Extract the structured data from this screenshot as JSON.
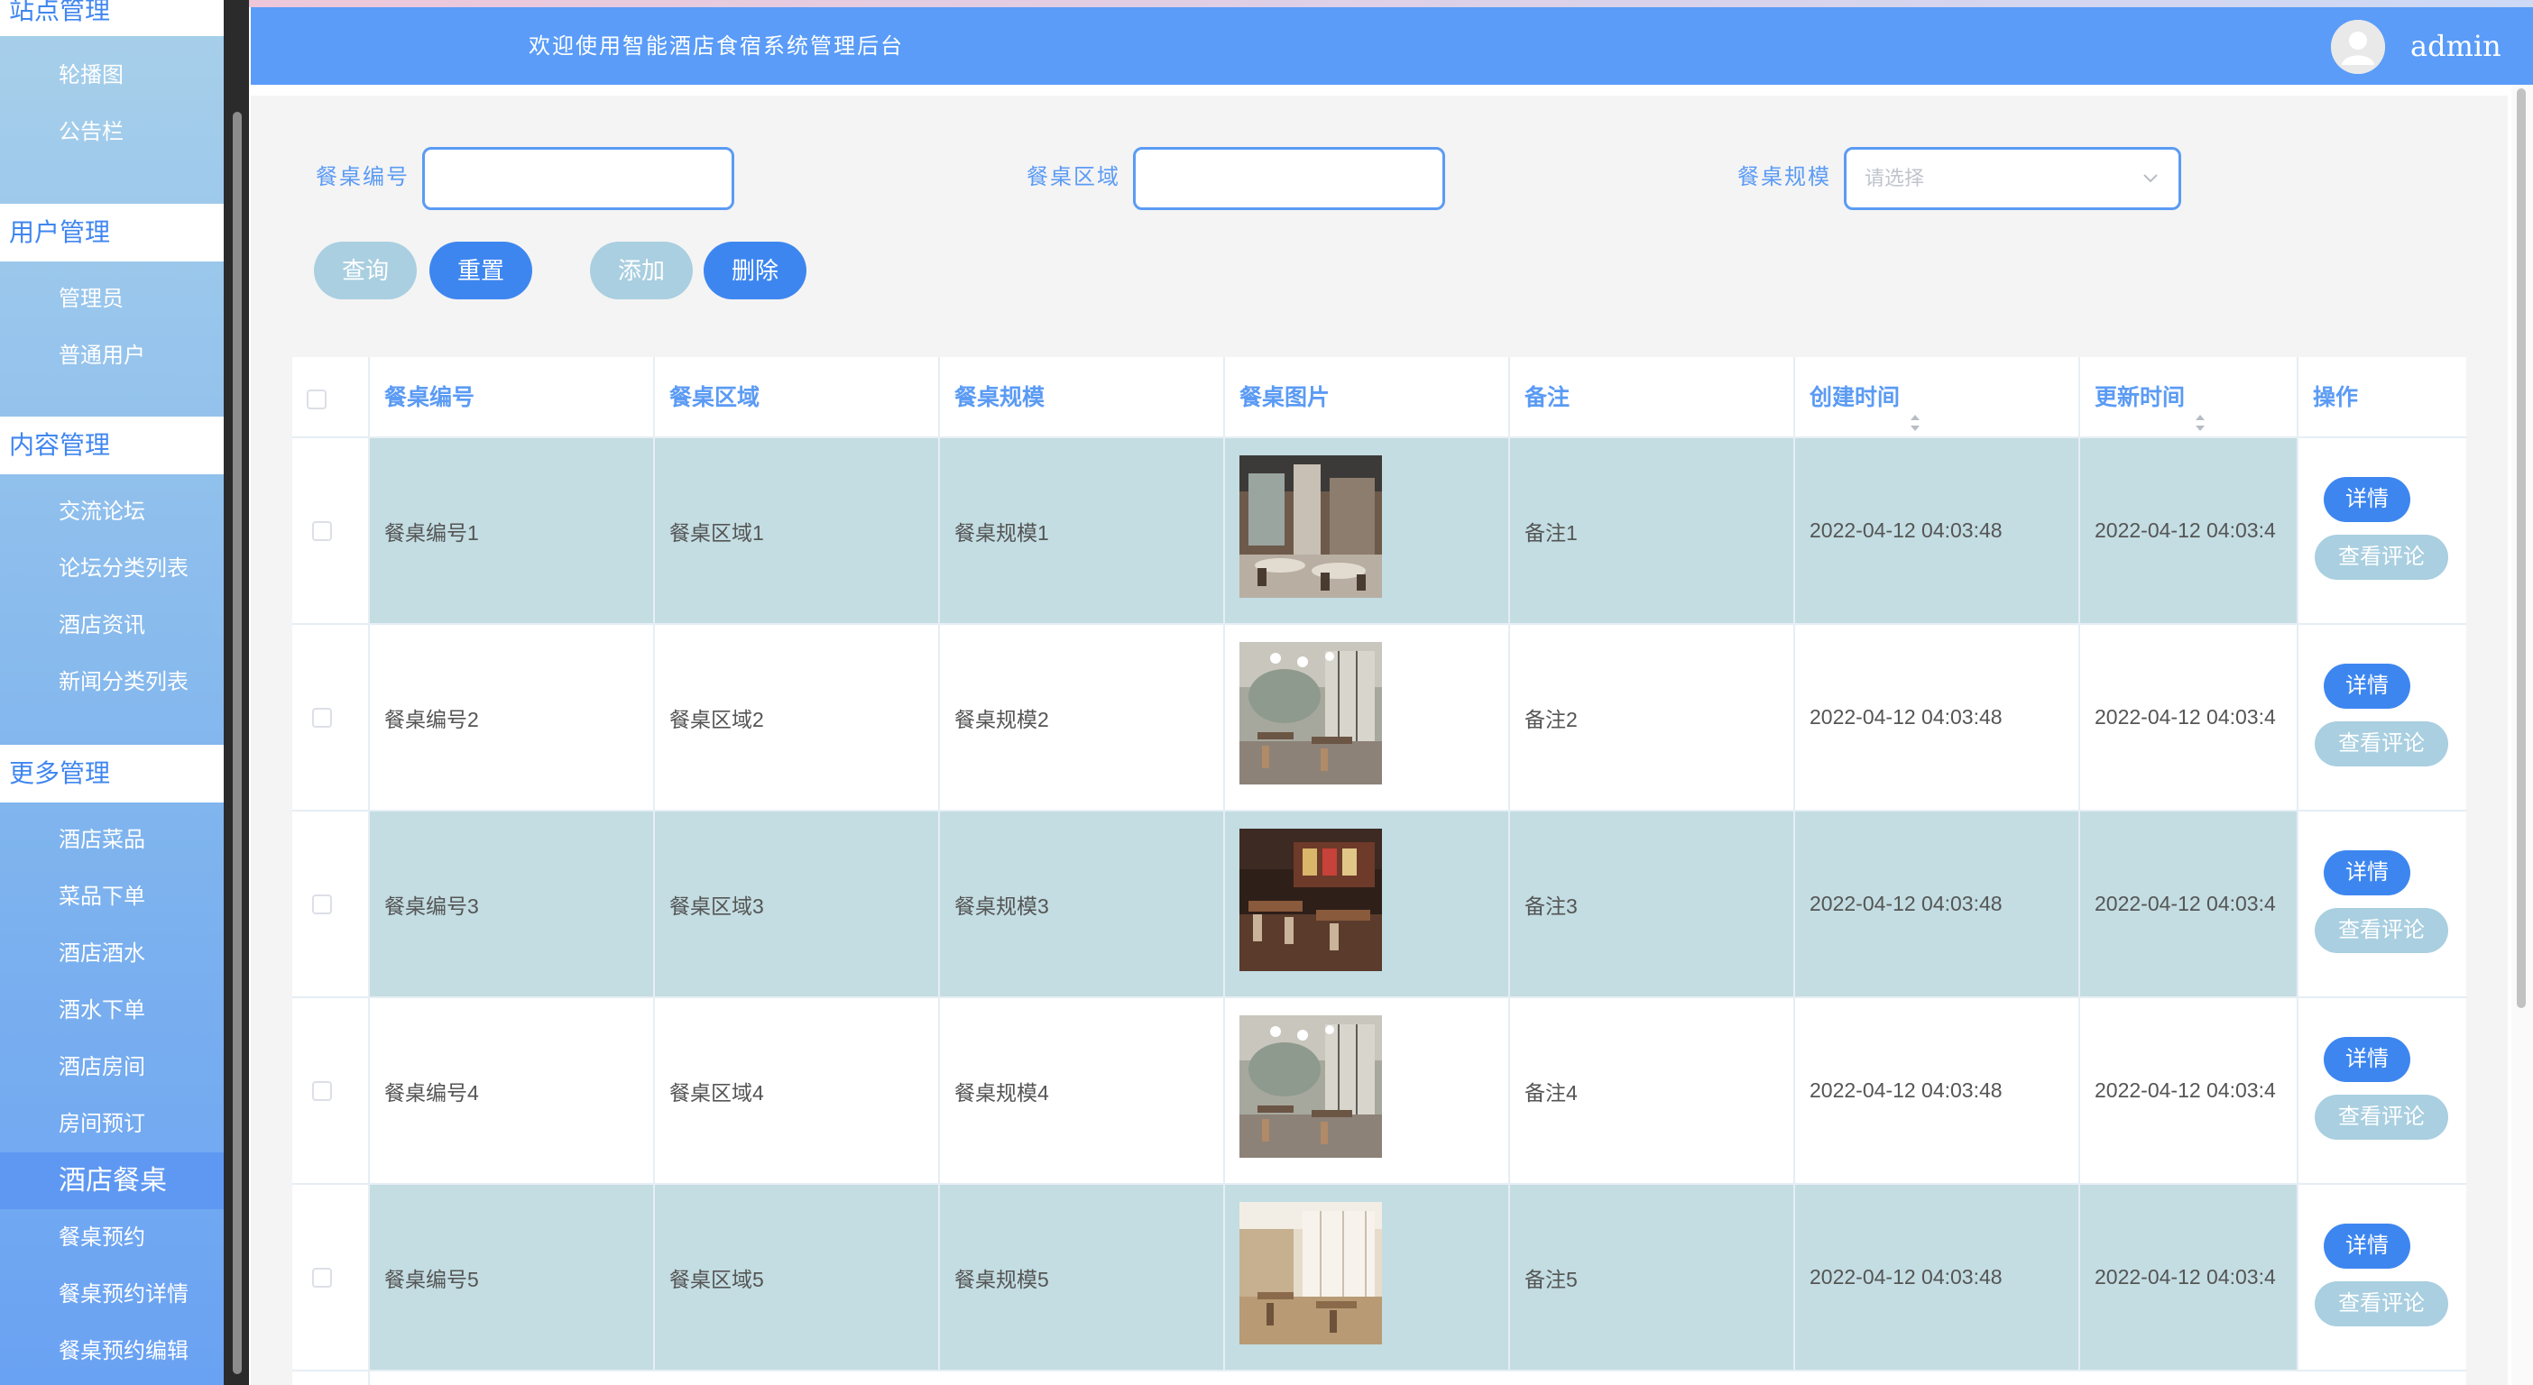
{
  "header": {
    "title": "欢迎使用智能酒店食宿系统管理后台",
    "user": "admin"
  },
  "sidebar": {
    "groups": [
      {
        "title": "站点管理",
        "items": [
          "轮播图",
          "公告栏"
        ]
      },
      {
        "title": "用户管理",
        "items": [
          "管理员",
          "普通用户"
        ]
      },
      {
        "title": "内容管理",
        "items": [
          "交流论坛",
          "论坛分类列表",
          "酒店资讯",
          "新闻分类列表"
        ]
      },
      {
        "title": "更多管理",
        "items": [
          "酒店菜品",
          "菜品下单",
          "酒店酒水",
          "酒水下单",
          "酒店房间",
          "房间预订",
          "酒店餐桌",
          "餐桌预约",
          "餐桌预约详情",
          "餐桌预约编辑"
        ]
      }
    ],
    "active_item": "酒店餐桌"
  },
  "filters": {
    "table_no_label": "餐桌编号",
    "table_no_value": "",
    "area_label": "餐桌区域",
    "area_value": "",
    "size_label": "餐桌规模",
    "size_placeholder": "请选择"
  },
  "actions": {
    "query": "查询",
    "reset": "重置",
    "add": "添加",
    "delete": "删除"
  },
  "table": {
    "columns": [
      "餐桌编号",
      "餐桌区域",
      "餐桌规模",
      "餐桌图片",
      "备注",
      "创建时间",
      "更新时间",
      "操作"
    ],
    "rows": [
      {
        "no": "餐桌编号1",
        "area": "餐桌区域1",
        "size": "餐桌规模1",
        "image": "restaurant-photo-1",
        "note": "备注1",
        "created": "2022-04-12 04:03:48",
        "updated": "2022-04-12 04:03:4"
      },
      {
        "no": "餐桌编号2",
        "area": "餐桌区域2",
        "size": "餐桌规模2",
        "image": "restaurant-photo-2",
        "note": "备注2",
        "created": "2022-04-12 04:03:48",
        "updated": "2022-04-12 04:03:4"
      },
      {
        "no": "餐桌编号3",
        "area": "餐桌区域3",
        "size": "餐桌规模3",
        "image": "restaurant-photo-3",
        "note": "备注3",
        "created": "2022-04-12 04:03:48",
        "updated": "2022-04-12 04:03:4"
      },
      {
        "no": "餐桌编号4",
        "area": "餐桌区域4",
        "size": "餐桌规模4",
        "image": "restaurant-photo-4",
        "note": "备注4",
        "created": "2022-04-12 04:03:48",
        "updated": "2022-04-12 04:03:4"
      },
      {
        "no": "餐桌编号5",
        "area": "餐桌区域5",
        "size": "餐桌规模5",
        "image": "restaurant-photo-5",
        "note": "备注5",
        "created": "2022-04-12 04:03:48",
        "updated": "2022-04-12 04:03:4"
      }
    ],
    "row_actions": {
      "detail": "详情",
      "comments": "查看评论"
    }
  },
  "colors": {
    "primary": "#3d86f0",
    "header_bg": "#5a9cf8",
    "light_button": "#a9cfe0",
    "row_highlight": "#c3dde2",
    "label_text": "#5b9bf4"
  },
  "icons": [
    "user-avatar-icon",
    "chevron-down-icon",
    "sort-caret-icon",
    "checkbox-icon"
  ]
}
